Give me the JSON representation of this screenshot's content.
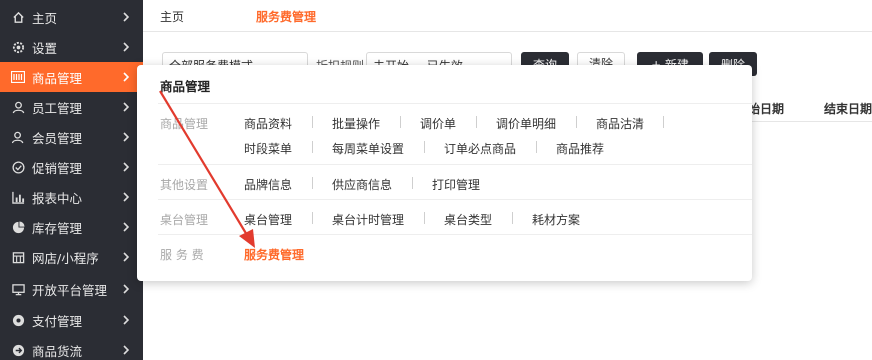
{
  "sidebar": {
    "items": [
      {
        "label": "主页",
        "icon": "home-icon"
      },
      {
        "label": "设置",
        "icon": "gear-icon"
      },
      {
        "label": "商品管理",
        "icon": "goods-icon",
        "active": true
      },
      {
        "label": "员工管理",
        "icon": "staff-icon"
      },
      {
        "label": "会员管理",
        "icon": "member-icon"
      },
      {
        "label": "促销管理",
        "icon": "promo-icon"
      },
      {
        "label": "报表中心",
        "icon": "report-icon"
      },
      {
        "label": "库存管理",
        "icon": "pie-icon"
      },
      {
        "label": "网店/小程序",
        "icon": "store-icon"
      },
      {
        "label": "开放平台管理",
        "icon": "monitor-icon"
      },
      {
        "label": "支付管理",
        "icon": "pay-icon"
      },
      {
        "label": "商品货流",
        "icon": "flow-icon"
      }
    ]
  },
  "tabs": {
    "home": "主页",
    "active": "服务费管理"
  },
  "toolbar": {
    "select1": "全部服务费模式",
    "label2": "折扣规则",
    "chip1": "未开始",
    "chip2": "已生效",
    "query": "查询",
    "clear": "清除",
    "add": "+ 新建",
    "delete": "删除"
  },
  "table": {
    "headers": [
      "开始日期",
      "结束日期"
    ]
  },
  "menu": {
    "title": "商品管理",
    "groups": [
      {
        "label": "商品管理",
        "rows": [
          [
            "商品资料",
            "批量操作",
            "调价单",
            "调价单明细",
            "商品沽清"
          ],
          [
            "时段菜单",
            "每周菜单设置",
            "订单必点商品",
            "商品推荐"
          ]
        ]
      },
      {
        "label": "其他设置",
        "rows": [
          [
            "品牌信息",
            "供应商信息",
            "打印管理"
          ]
        ]
      },
      {
        "label": "桌台管理",
        "rows": [
          [
            "桌台管理",
            "桌台计时管理",
            "桌台类型",
            "耗材方案"
          ]
        ]
      },
      {
        "label": "服 务 费",
        "rows": [
          [
            "服务费管理"
          ]
        ]
      }
    ]
  },
  "colors": {
    "accent": "#ff6a2b",
    "sidebar": "#2b2d34"
  }
}
